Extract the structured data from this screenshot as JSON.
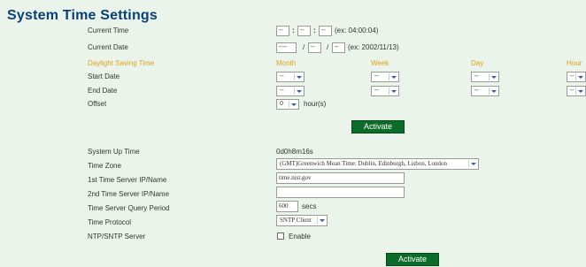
{
  "page": {
    "title": "System Time Settings"
  },
  "time": {
    "current_time_label": "Current Time",
    "time_hour": "--",
    "time_min": "--",
    "time_sec": "--",
    "sep1": ":",
    "sep2": ":",
    "time_example": "(ex: 04:00:04)",
    "current_date_label": "Current Date",
    "date_year": "----",
    "date_month": "--",
    "date_day": "--",
    "dsep1": "/",
    "dsep2": "/",
    "date_example": "(ex: 2002/11/13)"
  },
  "dst": {
    "heading": "Daylight Saving Time",
    "col_month": "Month",
    "col_week": "Week",
    "col_day": "Day",
    "col_hour": "Hour",
    "start_label": "Start Date",
    "end_label": "End Date",
    "start": {
      "month": "--",
      "week": "--",
      "day": "--",
      "hour": "--"
    },
    "end": {
      "month": "--",
      "week": "--",
      "day": "--",
      "hour": "--"
    },
    "offset_label": "Offset",
    "offset_value": "0",
    "offset_unit": "hour(s)",
    "activate_label": "Activate"
  },
  "server": {
    "uptime_label": "System Up Time",
    "uptime_value": "0d0h8m16s",
    "timezone_label": "Time Zone",
    "timezone_value": "(GMT)Greenwich Mean Time: Dublin, Edinburgh, Lisbon, London",
    "server1_label": "1st Time Server IP/Name",
    "server1_value": "time.nist.gov",
    "server2_label": "2nd Time Server IP/Name",
    "server2_value": "",
    "period_label": "Time Server Query Period",
    "period_value": "600",
    "period_unit": "secs",
    "protocol_label": "Time Protocol",
    "protocol_value": "SNTP Client",
    "ntp_label": "NTP/SNTP Server",
    "enable_label": "Enable",
    "enable_checked": false,
    "activate_label": "Activate"
  },
  "colors": {
    "title": "#0a3f78",
    "dst_heading": "#e0a020",
    "button": "#0b6b28",
    "background": "#eaf4ea"
  }
}
